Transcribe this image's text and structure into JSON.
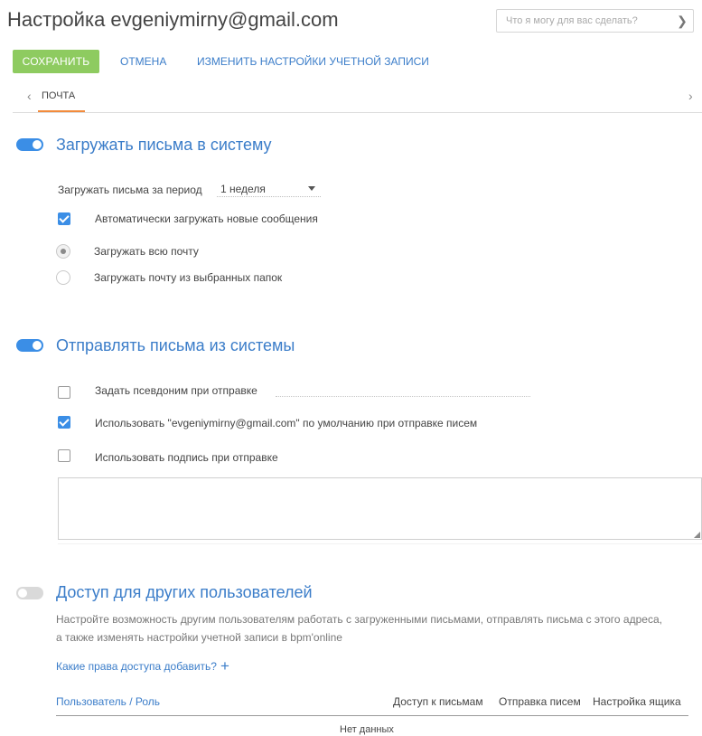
{
  "header": {
    "title": "Настройка evgeniymirny@gmail.com",
    "search_placeholder": "Что я могу для вас сделать?"
  },
  "toolbar": {
    "save_label": "СОХРАНИТЬ",
    "cancel_label": "ОТМЕНА",
    "edit_account_label": "ИЗМЕНИТЬ НАСТРОЙКИ УЧЕТНОЙ ЗАПИСИ"
  },
  "tabs": [
    {
      "label": "ПОЧТА",
      "active": true
    }
  ],
  "load_section": {
    "title": "Загружать письма в систему",
    "enabled": true,
    "period_label": "Загружать письма за период",
    "period_value": "1 неделя",
    "auto_load_label": "Автоматически загружать новые сообщения",
    "auto_load_checked": true,
    "radio_all_label": "Загружать всю почту",
    "radio_selected_label": "Загружать почту из выбранных папок",
    "selected_radio": "all"
  },
  "send_section": {
    "title": "Отправлять письма из системы",
    "enabled": true,
    "alias_label": "Задать псевдоним при отправке",
    "alias_checked": false,
    "default_label": "Использовать \"evgeniymirny@gmail.com\" по умолчанию при отправке писем",
    "default_checked": true,
    "signature_label": "Использовать подпись при отправке",
    "signature_checked": false
  },
  "access_section": {
    "title": "Доступ для других пользователей",
    "enabled": false,
    "description_line1": "Настройте возможность другим пользователям работать с загруженными письмами, отправлять письма с этого адреса,",
    "description_line2": "а также изменять настройки  учетной записи в bpm'online",
    "add_link_label": "Какие права доступа добавить?",
    "table_headers": {
      "user_role": "Пользователь / Роль",
      "mail_access": "Доступ к письмам",
      "send_mail": "Отправка писем",
      "mailbox_settings": "Настройка ящика"
    },
    "empty_text": "Нет данных"
  },
  "colors": {
    "accent": "#3b8ee6",
    "link": "#3b7dc9",
    "save_button": "#8ecb60",
    "tab_underline": "#f38b3c"
  }
}
